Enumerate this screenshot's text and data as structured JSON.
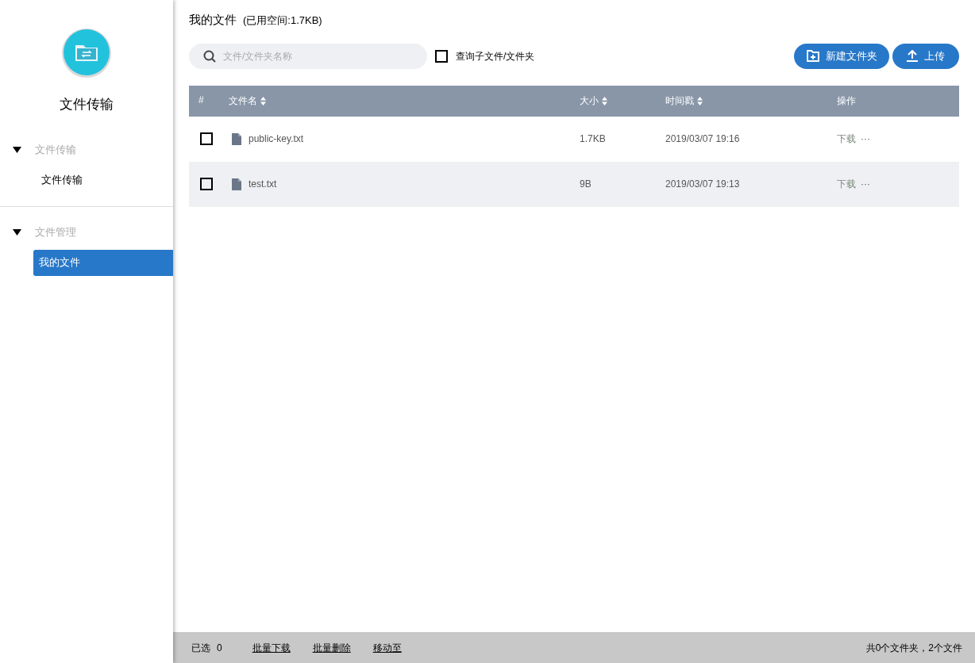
{
  "app": {
    "title": "文件传输"
  },
  "sidebar": {
    "groups": [
      {
        "label": "文件传输",
        "expanded": true,
        "items": [
          {
            "label": "文件传输",
            "selected": false
          }
        ]
      },
      {
        "label": "文件管理",
        "expanded": true,
        "items": [
          {
            "label": "我的文件",
            "selected": true
          }
        ]
      }
    ]
  },
  "header": {
    "title": "我的文件",
    "usage": "(已用空间:1.7KB)"
  },
  "search": {
    "placeholder": "文件/文件夹名称"
  },
  "subfolder_option": {
    "label": "查询子文件/文件夹",
    "checked": false
  },
  "buttons": [
    {
      "kind": "new-folder",
      "label": "新建文件夹"
    },
    {
      "kind": "upload",
      "label": "上传"
    }
  ],
  "table": {
    "columns": [
      {
        "label": "#",
        "sortable": false
      },
      {
        "label": "文件名",
        "sortable": true
      },
      {
        "label": "大小",
        "sortable": true
      },
      {
        "label": "时间戳",
        "sortable": true
      },
      {
        "label": "操作",
        "sortable": false
      }
    ],
    "rows": [
      {
        "checked": false,
        "name": "public-key.txt",
        "size": "1.7KB",
        "time": "2019/03/07 19:16",
        "action": "下载",
        "more": "···"
      },
      {
        "checked": false,
        "name": "test.txt",
        "size": "9B",
        "time": "2019/03/07 19:13",
        "action": "下载",
        "more": "···"
      }
    ]
  },
  "footer": {
    "selected_label": "已选",
    "selected_count": "0",
    "actions": [
      "批量下载",
      "批量删除",
      "移动至"
    ],
    "summary": "共0个文件夹，2个文件"
  }
}
